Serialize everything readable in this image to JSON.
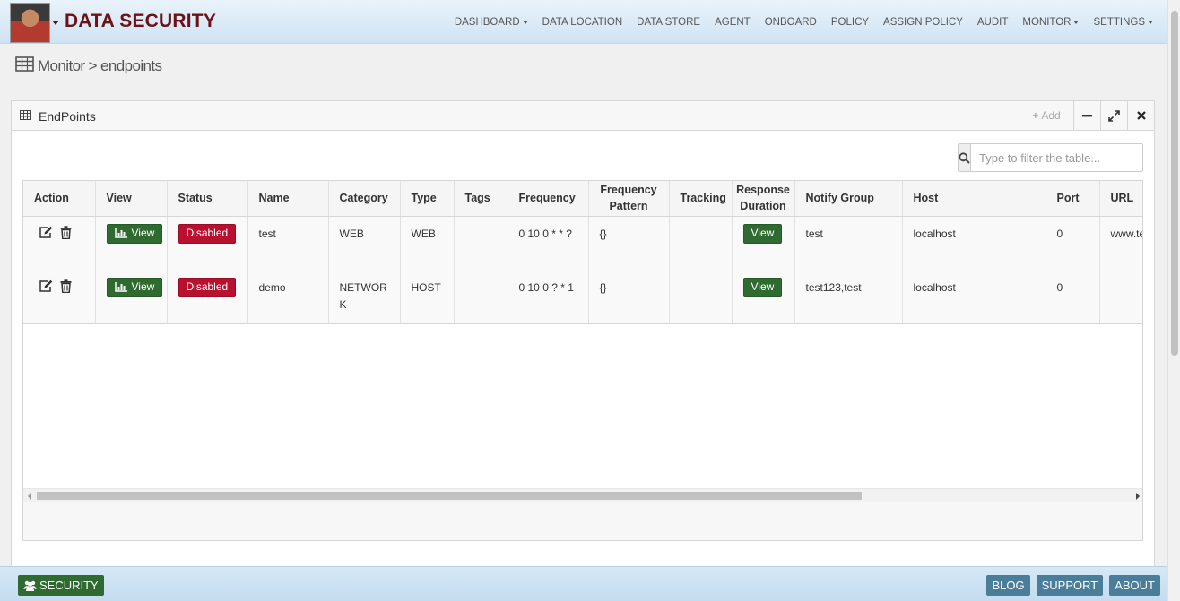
{
  "header": {
    "brand": "DATA SECURITY",
    "nav": [
      {
        "label": "DASHBOARD",
        "caret": true
      },
      {
        "label": "DATA LOCATION",
        "caret": false
      },
      {
        "label": "DATA STORE",
        "caret": false
      },
      {
        "label": "AGENT",
        "caret": false
      },
      {
        "label": "ONBOARD",
        "caret": false
      },
      {
        "label": "POLICY",
        "caret": false
      },
      {
        "label": "ASSIGN POLICY",
        "caret": false
      },
      {
        "label": "AUDIT",
        "caret": false
      },
      {
        "label": "MONITOR",
        "caret": true
      },
      {
        "label": "SETTINGS",
        "caret": true
      }
    ]
  },
  "breadcrumb": "Monitor > endpoints",
  "panel": {
    "title": "EndPoints",
    "add_label": "Add",
    "filter_placeholder": "Type to filter the table..."
  },
  "table": {
    "columns": [
      "Action",
      "View",
      "Status",
      "Name",
      "Category",
      "Type",
      "Tags",
      "Frequency",
      "Frequency Pattern",
      "Tracking",
      "Response Duration",
      "Notify Group",
      "Host",
      "Port",
      "URL"
    ],
    "view_label": "View",
    "rows": [
      {
        "status": "Disabled",
        "name": "test",
        "category": "WEB",
        "type": "WEB",
        "tags": "",
        "frequency": "0 10 0 * * ?",
        "pattern": "{}",
        "tracking": "",
        "response": "View",
        "notify": "test",
        "host": "localhost",
        "port": "0",
        "url": "www.test.com"
      },
      {
        "status": "Disabled",
        "name": "demo",
        "category": "NETWORK",
        "type": "HOST",
        "tags": "",
        "frequency": "0 10 0 ? * 1",
        "pattern": "{}",
        "tracking": "",
        "response": "View",
        "notify": "test123,test",
        "host": "localhost",
        "port": "0",
        "url": ""
      }
    ]
  },
  "footer": {
    "security_label": "SECURITY",
    "links": [
      "BLOG",
      "SUPPORT",
      "ABOUT"
    ]
  },
  "colors": {
    "brand": "#6b1219",
    "success": "#2f6b31",
    "danger": "#b8102e",
    "footer_button": "#4a7d99"
  }
}
